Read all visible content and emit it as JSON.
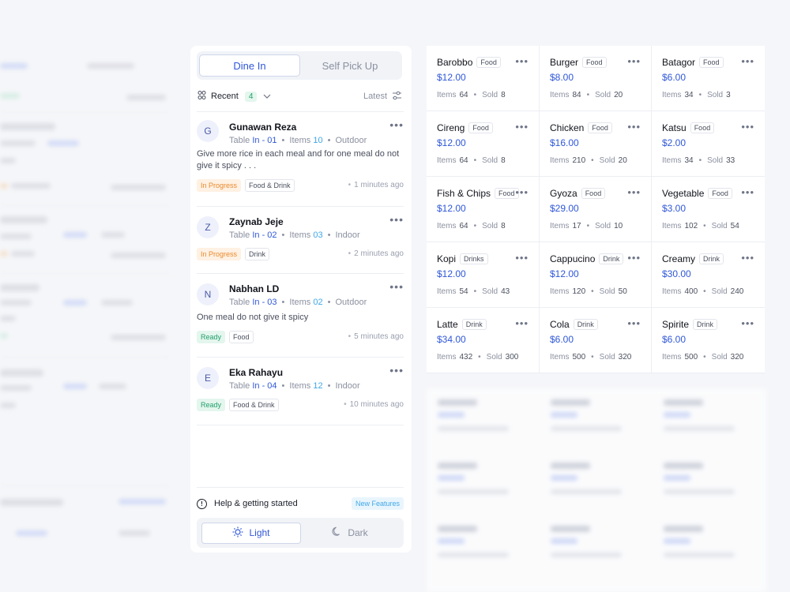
{
  "order_type_tabs": [
    {
      "label": "Dine In",
      "active": true
    },
    {
      "label": "Self Pick Up",
      "active": false
    }
  ],
  "filter": {
    "recent_label": "Recent",
    "recent_count": "4",
    "sort_label": "Latest"
  },
  "orders": [
    {
      "initial": "G",
      "name": "Gunawan Reza",
      "table_label": "Table",
      "table": "In - 01",
      "items_label": "Items",
      "items": "10",
      "location": "Outdoor",
      "note": "Give more rice in each meal and for one meal do not give it spicy . . .",
      "status": "In Progress",
      "category": "Food & Drink",
      "time": "1 minutes ago"
    },
    {
      "initial": "Z",
      "name": "Zaynab Jeje",
      "table_label": "Table",
      "table": "In - 02",
      "items_label": "Items",
      "items": "03",
      "location": "Indoor",
      "note": "",
      "status": "In Progress",
      "category": "Drink",
      "time": "2 minutes ago"
    },
    {
      "initial": "N",
      "name": "Nabhan LD",
      "table_label": "Table",
      "table": "In - 03",
      "items_label": "Items",
      "items": "02",
      "location": "Outdoor",
      "note": "One meal do not give it spicy",
      "status": "Ready",
      "category": "Food",
      "time": "5 minutes ago"
    },
    {
      "initial": "E",
      "name": "Eka Rahayu",
      "table_label": "Table",
      "table": "In - 04",
      "items_label": "Items",
      "items": "12",
      "location": "Indoor",
      "note": "",
      "status": "Ready",
      "category": "Food & Drink",
      "time": "10 minutes ago"
    }
  ],
  "help": {
    "label": "Help & getting started",
    "badge": "New Features"
  },
  "theme": [
    {
      "label": "Light",
      "active": true
    },
    {
      "label": "Dark",
      "active": false
    }
  ],
  "menu_stats_labels": {
    "items": "Items",
    "sold": "Sold"
  },
  "menu": [
    {
      "name": "Barobbo",
      "category": "Food",
      "price": "$12.00",
      "items": "64",
      "sold": "8"
    },
    {
      "name": "Burger",
      "category": "Food",
      "price": "$8.00",
      "items": "84",
      "sold": "20"
    },
    {
      "name": "Batagor",
      "category": "Food",
      "price": "$6.00",
      "items": "34",
      "sold": "3"
    },
    {
      "name": "Cireng",
      "category": "Food",
      "price": "$12.00",
      "items": "64",
      "sold": "8"
    },
    {
      "name": "Chicken",
      "category": "Food",
      "price": "$16.00",
      "items": "210",
      "sold": "20"
    },
    {
      "name": "Katsu",
      "category": "Food",
      "price": "$2.00",
      "items": "34",
      "sold": "33"
    },
    {
      "name": "Fish & Chips",
      "category": "Food",
      "price": "$12.00",
      "items": "64",
      "sold": "8"
    },
    {
      "name": "Gyoza",
      "category": "Food",
      "price": "$29.00",
      "items": "17",
      "sold": "10"
    },
    {
      "name": "Vegetable",
      "category": "Food",
      "price": "$3.00",
      "items": "102",
      "sold": "54"
    },
    {
      "name": "Kopi",
      "category": "Drinks",
      "price": "$12.00",
      "items": "54",
      "sold": "43"
    },
    {
      "name": "Cappucino",
      "category": "Drink",
      "price": "$12.00",
      "items": "120",
      "sold": "50"
    },
    {
      "name": "Creamy",
      "category": "Drink",
      "price": "$30.00",
      "items": "400",
      "sold": "240"
    },
    {
      "name": "Latte",
      "category": "Drink",
      "price": "$34.00",
      "items": "432",
      "sold": "300"
    },
    {
      "name": "Cola",
      "category": "Drink",
      "price": "$6.00",
      "items": "500",
      "sold": "320"
    },
    {
      "name": "Spirite",
      "category": "Drink",
      "price": "$6.00",
      "items": "500",
      "sold": "320"
    }
  ],
  "colors": {
    "accent": "#2f57d8",
    "in_progress": "#e98a2e",
    "ready": "#22a06b",
    "new_feature": "#3fa7e8"
  }
}
